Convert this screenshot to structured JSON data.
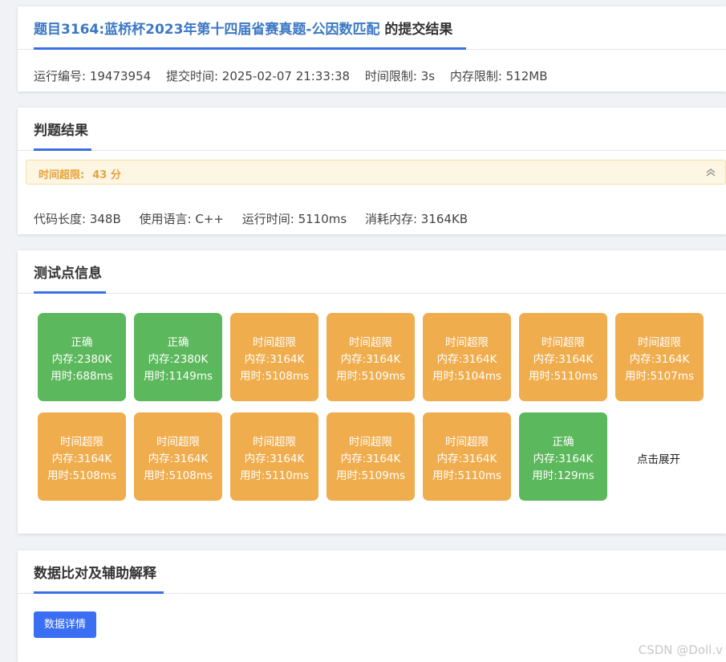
{
  "submission": {
    "title_link": "题目3164:蓝桥杯2023年第十四届省赛真题-公因数匹配",
    "title_suffix": " 的提交结果",
    "run_id": "运行编号: 19473954",
    "submit_time": "提交时间: 2025-02-07 21:33:38",
    "time_limit": "时间限制: 3s",
    "memory_limit": "内存限制: 512MB"
  },
  "judge": {
    "title": "判题结果",
    "verdict": "时间超限:",
    "score": "43 分",
    "code_length": "代码长度: 348B",
    "language": "使用语言: C++",
    "run_time": "运行时间: 5110ms",
    "memory_used": "消耗内存: 3164KB"
  },
  "testcases": {
    "title": "测试点信息",
    "items": [
      {
        "status": "正确",
        "memory": "内存:2380K",
        "time": "用时:688ms",
        "kind": "ok"
      },
      {
        "status": "正确",
        "memory": "内存:2380K",
        "time": "用时:1149ms",
        "kind": "ok"
      },
      {
        "status": "时间超限",
        "memory": "内存:3164K",
        "time": "用时:5108ms",
        "kind": "tle"
      },
      {
        "status": "时间超限",
        "memory": "内存:3164K",
        "time": "用时:5109ms",
        "kind": "tle"
      },
      {
        "status": "时间超限",
        "memory": "内存:3164K",
        "time": "用时:5104ms",
        "kind": "tle"
      },
      {
        "status": "时间超限",
        "memory": "内存:3164K",
        "time": "用时:5110ms",
        "kind": "tle"
      },
      {
        "status": "时间超限",
        "memory": "内存:3164K",
        "time": "用时:5107ms",
        "kind": "tle"
      },
      {
        "status": "时间超限",
        "memory": "内存:3164K",
        "time": "用时:5108ms",
        "kind": "tle"
      },
      {
        "status": "时间超限",
        "memory": "内存:3164K",
        "time": "用时:5108ms",
        "kind": "tle"
      },
      {
        "status": "时间超限",
        "memory": "内存:3164K",
        "time": "用时:5110ms",
        "kind": "tle"
      },
      {
        "status": "时间超限",
        "memory": "内存:3164K",
        "time": "用时:5109ms",
        "kind": "tle"
      },
      {
        "status": "时间超限",
        "memory": "内存:3164K",
        "time": "用时:5110ms",
        "kind": "tle"
      },
      {
        "status": "正确",
        "memory": "内存:3164K",
        "time": "用时:129ms",
        "kind": "ok"
      }
    ],
    "expand_label": "点击展开"
  },
  "compare": {
    "title": "数据比对及辅助解释",
    "button_label": "数据详情"
  },
  "watermark": "CSDN @Doll.v",
  "colors": {
    "accent": "#3b6fe6",
    "link": "#3b78c5",
    "ok": "#5cb85c",
    "tle": "#f0ad4e",
    "warning_text": "#e6a23c",
    "warning_bg": "#fdf6e3"
  },
  "icons": {
    "collapse": "double-chevron-up-icon"
  }
}
